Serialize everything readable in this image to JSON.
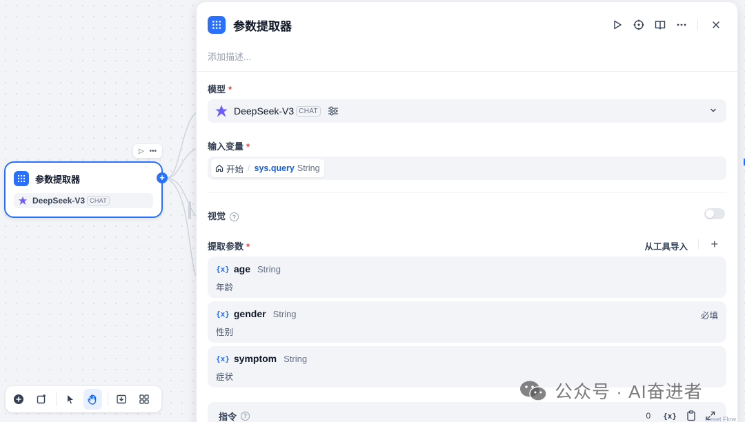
{
  "node": {
    "title": "参数提取器",
    "model_name": "DeepSeek-V3",
    "model_badge": "CHAT"
  },
  "panel": {
    "title": "参数提取器",
    "description_placeholder": "添加描述...",
    "model_label": "模型",
    "model_name": "DeepSeek-V3",
    "model_badge": "CHAT",
    "input_label": "输入变量",
    "input_var": {
      "source": "开始",
      "separator": "/",
      "name": "sys.query",
      "type": "String"
    },
    "vision_label": "视觉",
    "extract_label": "提取参数",
    "import_label": "从工具导入",
    "required_mark": "*",
    "params": [
      {
        "name": "age",
        "type": "String",
        "desc": "年龄",
        "required": ""
      },
      {
        "name": "gender",
        "type": "String",
        "desc": "性别",
        "required": "必填"
      },
      {
        "name": "symptom",
        "type": "String",
        "desc": "症状",
        "required": ""
      }
    ],
    "param_icon": "{x}",
    "instruction_label": "指令",
    "instruction_count": "0",
    "help_glyph": "?"
  },
  "watermark": {
    "text": "公众号 · AI奋进者"
  },
  "minimap_label": "Reset Flow",
  "colors": {
    "accent": "#2970ff",
    "required": "#f04438",
    "variable": "#155eef"
  }
}
